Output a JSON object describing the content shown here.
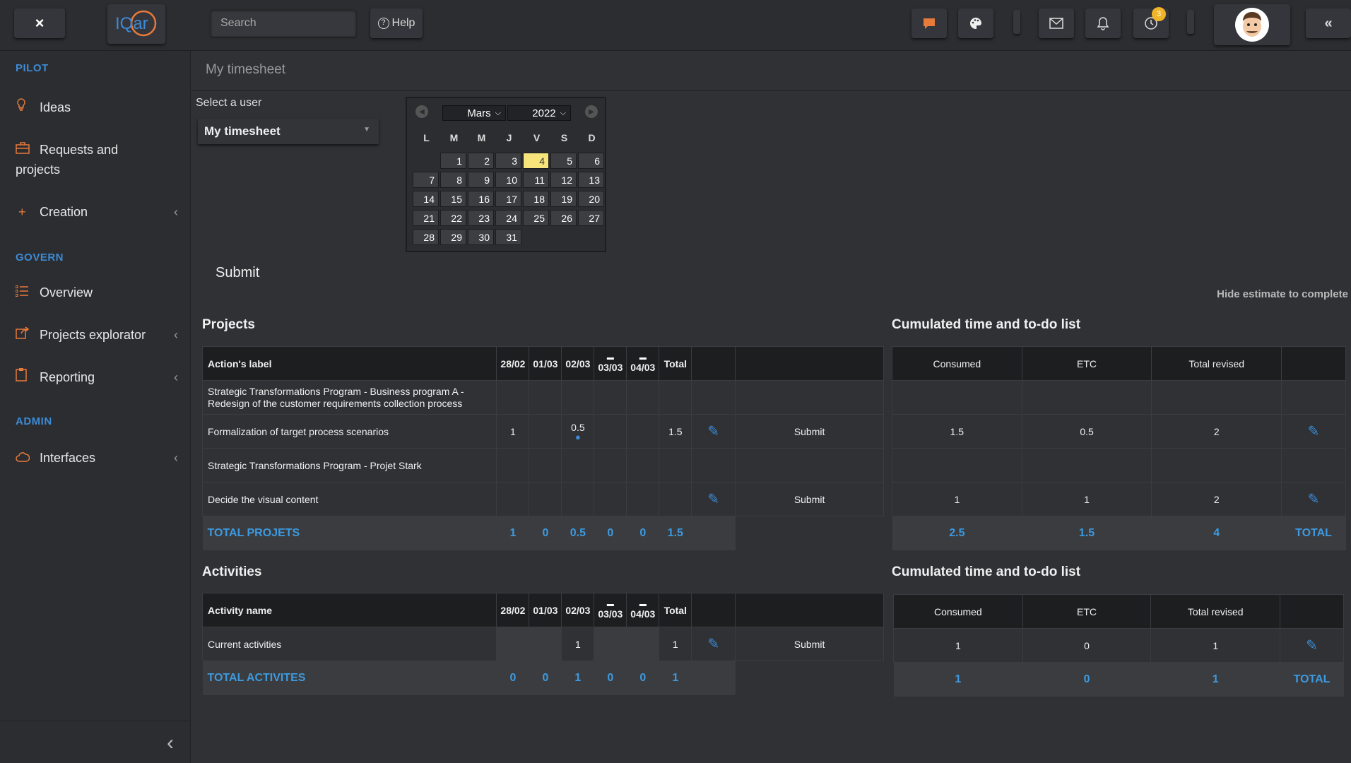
{
  "topbar": {
    "close_label": "×",
    "logo_text": "IQar",
    "search_placeholder": "Search",
    "help_label": "Help",
    "notification_count": "3"
  },
  "sidebar": {
    "sections": [
      {
        "title": "PILOT",
        "items": [
          {
            "label": "Ideas",
            "icon": "lightbulb-icon"
          },
          {
            "label": "Requests and projects",
            "icon": "briefcase-icon"
          },
          {
            "label": "Creation",
            "icon": "plus-icon",
            "has_chevron": true
          }
        ]
      },
      {
        "title": "GOVERN",
        "items": [
          {
            "label": "Overview",
            "icon": "list-icon"
          },
          {
            "label": "Projects explorator",
            "icon": "share-icon",
            "has_chevron": true
          },
          {
            "label": "Reporting",
            "icon": "clipboard-icon",
            "has_chevron": true
          }
        ]
      },
      {
        "title": "ADMIN",
        "items": [
          {
            "label": "Interfaces",
            "icon": "cloud-icon",
            "has_chevron": true
          }
        ]
      }
    ]
  },
  "page": {
    "title": "My timesheet",
    "select_label": "Select a user",
    "select_value": "My timesheet",
    "submit_label": "Submit",
    "hide_estimate": "Hide estimate to complete"
  },
  "calendar": {
    "month": "Mars",
    "year": "2022",
    "weekdays": [
      "L",
      "M",
      "M",
      "J",
      "V",
      "S",
      "D"
    ],
    "start_offset": 1,
    "days_in_month": 31,
    "today": 4
  },
  "projects": {
    "title": "Projects",
    "headers": {
      "label": "Action's label",
      "d1": "28/02",
      "d2": "01/03",
      "d3": "02/03",
      "d4": "03/03",
      "d5": "04/03",
      "total": "Total"
    },
    "rows": [
      {
        "label": "Strategic Transformations Program - Business program A - Redesign of the customer requirements collection process",
        "type": "group"
      },
      {
        "label": "Formalization of target process scenarios",
        "d1": "1",
        "d3": "0.5",
        "total": "1.5",
        "submit": "Submit",
        "type": "task"
      },
      {
        "label": "Strategic Transformations Program - Projet Stark",
        "type": "group"
      },
      {
        "label": "Decide the visual content",
        "submit": "Submit",
        "type": "task"
      }
    ],
    "total": {
      "label": "TOTAL PROJETS",
      "d1": "1",
      "d2": "0",
      "d3": "0.5",
      "d4": "0",
      "d5": "0",
      "total": "1.5"
    }
  },
  "projects_cumul": {
    "title": "Cumulated time and to-do list",
    "headers": {
      "consumed": "Consumed",
      "etc": "ETC",
      "revised": "Total revised"
    },
    "rows": [
      {
        "consumed": "",
        "etc": "",
        "revised": ""
      },
      {
        "consumed": "1.5",
        "etc": "0.5",
        "revised": "2"
      },
      {
        "consumed": "",
        "etc": "",
        "revised": ""
      },
      {
        "consumed": "1",
        "etc": "1",
        "revised": "2"
      }
    ],
    "total": {
      "consumed": "2.5",
      "etc": "1.5",
      "revised": "4",
      "label": "TOTAL"
    }
  },
  "activities": {
    "title": "Activities",
    "headers": {
      "label": "Activity name",
      "d1": "28/02",
      "d2": "01/03",
      "d3": "02/03",
      "d4": "03/03",
      "d5": "04/03",
      "total": "Total"
    },
    "row": {
      "label": "Current activities",
      "d3": "1",
      "total": "1",
      "submit": "Submit"
    },
    "total": {
      "label": "TOTAL ACTIVITES",
      "d1": "0",
      "d2": "0",
      "d3": "1",
      "d4": "0",
      "d5": "0",
      "total": "1"
    }
  },
  "activities_cumul": {
    "title": "Cumulated time and to-do list",
    "headers": {
      "consumed": "Consumed",
      "etc": "ETC",
      "revised": "Total revised"
    },
    "row": {
      "consumed": "1",
      "etc": "0",
      "revised": "1"
    },
    "total": {
      "consumed": "1",
      "etc": "0",
      "revised": "1",
      "label": "TOTAL"
    }
  },
  "colors": {
    "accent": "#3d8bd6",
    "today": "#f7e57b",
    "icon_orange": "#e87a3c"
  }
}
